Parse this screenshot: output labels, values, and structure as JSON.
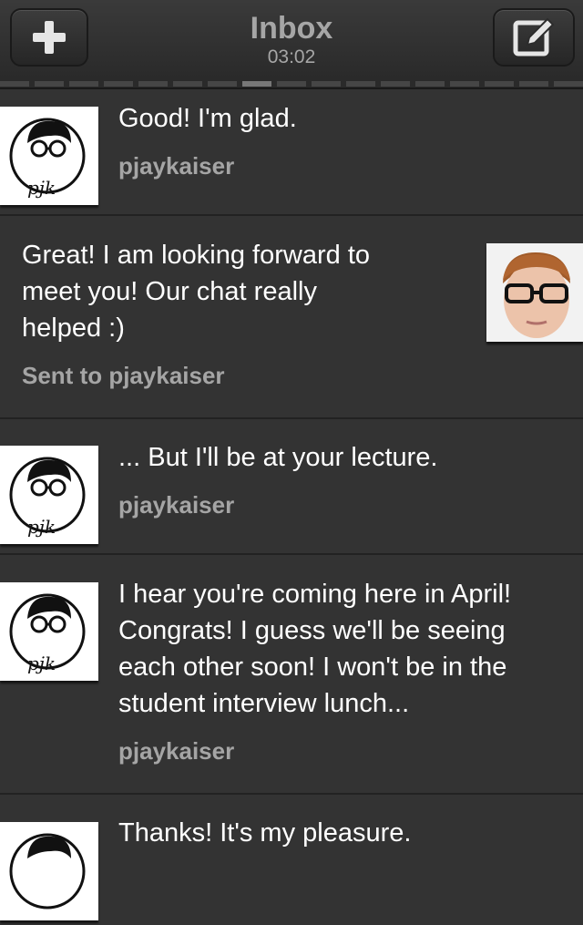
{
  "header": {
    "title": "Inbox",
    "time": "03:02",
    "left_button_icon": "plus-icon",
    "right_button_icon": "compose-icon"
  },
  "messages": [
    {
      "lines": [
        "Good! I'm glad."
      ],
      "sender": "pjaykaiser",
      "avatar_icon": "pjk-logo-avatar",
      "side": "left"
    },
    {
      "lines": [
        "Great! I am looking forward to",
        "meet you! Our chat really",
        "helped :)"
      ],
      "sender": "Sent to pjaykaiser",
      "avatar_icon": "user-photo-avatar",
      "side": "right"
    },
    {
      "lines": [
        "... But I'll be at your lecture."
      ],
      "sender": "pjaykaiser",
      "avatar_icon": "pjk-logo-avatar",
      "side": "left"
    },
    {
      "lines": [
        "I hear you're coming here in April!",
        "Congrats! I guess we'll be seeing",
        "each other soon! I won't be in the",
        "student interview lunch..."
      ],
      "sender": "pjaykaiser",
      "avatar_icon": "pjk-logo-avatar",
      "side": "left"
    },
    {
      "lines": [
        "Thanks! It's my pleasure."
      ],
      "sender": "",
      "avatar_icon": "pjk-logo-avatar",
      "side": "left"
    }
  ],
  "colors": {
    "background": "#333333",
    "text": "#ffffff",
    "secondary_text": "#a5a5a5",
    "divider": "#222222"
  }
}
